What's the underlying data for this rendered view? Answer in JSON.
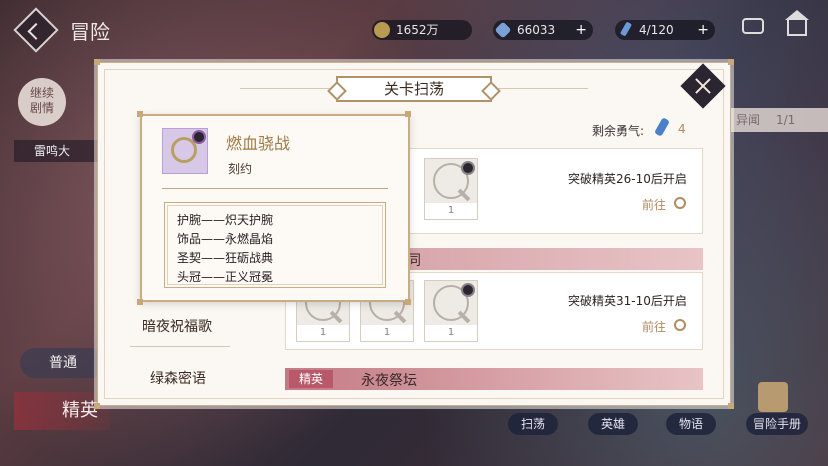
{
  "top": {
    "title": "冒险",
    "gold": "1652万",
    "gems": "66033",
    "stamina": "4/120",
    "plus": "+"
  },
  "background": {
    "continue_story": [
      "继续",
      "剧情"
    ],
    "chapter_strip": "雷鸣大",
    "right_strip": "异闻",
    "right_strip_count": "1/1",
    "mode_normal": "普通",
    "mode_elite": "精英"
  },
  "bottom_nav": [
    "扫荡",
    "英雄",
    "物语",
    "冒险手册"
  ],
  "dialog": {
    "title": "关卡扫荡",
    "remaining_label": "剩余勇气:",
    "remaining_value": "4",
    "stages": [
      {
        "unlock": "突破精英26-10后开启",
        "goto": "前往",
        "items": [
          "1"
        ]
      },
      {
        "name": "同",
        "unlock": "突破精英31-10后开启",
        "goto": "前往",
        "items": [
          "1",
          "1",
          "1"
        ]
      },
      {
        "tag": "精英",
        "name": "永夜祭坛"
      }
    ],
    "side_list": [
      "暗夜祝福歌",
      "绿森密语"
    ]
  },
  "tooltip": {
    "name": "燃血骁战",
    "type": "刻约",
    "lines": [
      "护腕——炽天护腕",
      "饰品——永燃晶焰",
      "圣契——狂砺战典",
      "头冠——正义冠冕"
    ]
  },
  "colors": {
    "accent_gold": "#b08a60",
    "elite_red": "#b8586a",
    "dialog_bg": "#fbf7f2"
  }
}
